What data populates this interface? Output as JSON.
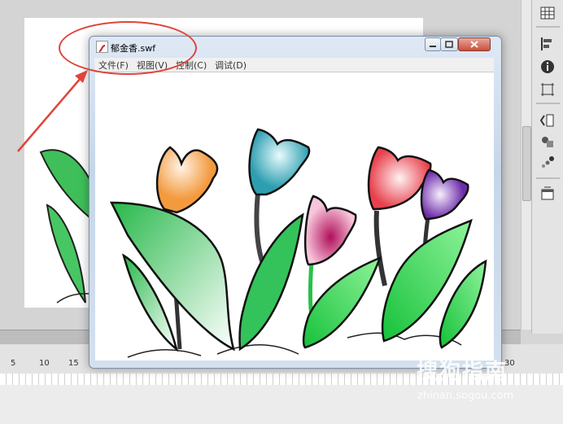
{
  "window": {
    "title": "郁金香.swf",
    "menu": [
      "文件(F)",
      "视图(V)",
      "控制(C)",
      "调试(D)"
    ]
  },
  "timeline": {
    "ruler_numbers": [
      "5",
      "10",
      "15",
      "30"
    ]
  },
  "right_toolbar": {
    "icons": [
      "grid-icon",
      "align-icon",
      "info-icon",
      "transform-icon",
      "code-snippets-icon",
      "components-icon",
      "motion-presets-icon",
      "library-icon"
    ]
  },
  "watermark": {
    "main": "搜狗指南",
    "sub": "zhinan.sogou.com"
  },
  "colors": {
    "annotation": "#e0443a",
    "window_frame": "#c6d6ea",
    "leaf_green": "#3fcf5a",
    "tulip_orange": "#f4a35a",
    "tulip_teal": "#3aa9b8",
    "tulip_magenta": "#c8176a",
    "tulip_red": "#e8505a",
    "tulip_purple": "#7a3fb0"
  }
}
